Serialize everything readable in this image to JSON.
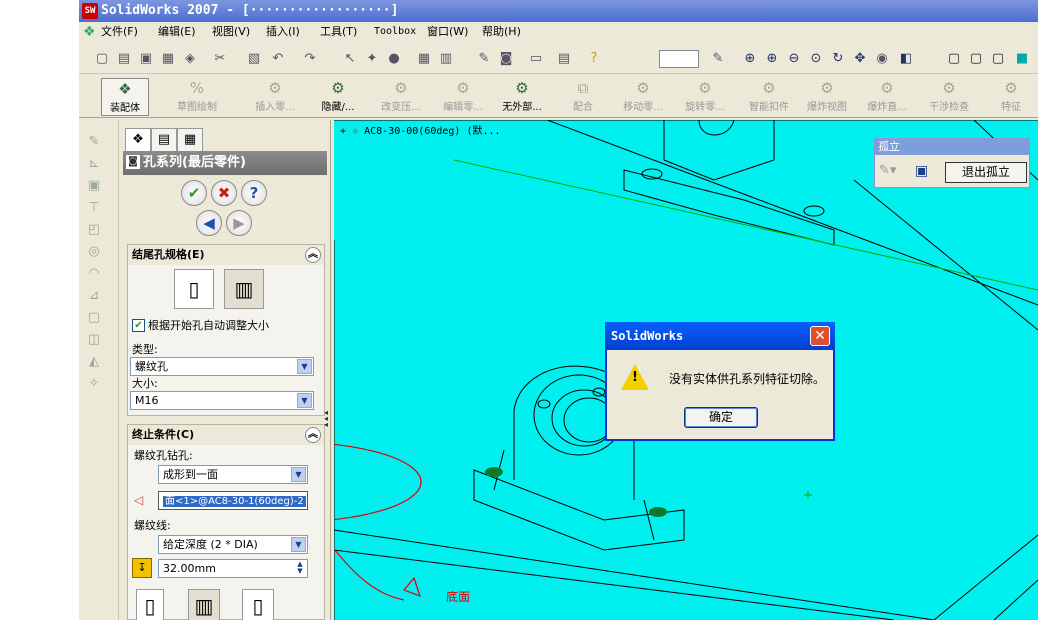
{
  "window": {
    "logo": "SW",
    "title": "SolidWorks 2007 - [··················]"
  },
  "menu": [
    "文件(F)",
    "编辑(E)",
    "视图(V)",
    "插入(I)",
    "工具(T)",
    "Toolbox",
    "窗口(W)",
    "帮助(H)"
  ],
  "command_bar": [
    {
      "label": "装配体",
      "active": true
    },
    {
      "label": "草图绘制",
      "active": false
    },
    {
      "label": "插入零...",
      "active": false
    },
    {
      "label": "隐藏/...",
      "active": true
    },
    {
      "label": "改变压...",
      "active": false
    },
    {
      "label": "编辑零...",
      "active": false
    },
    {
      "label": "无外部...",
      "active": true
    },
    {
      "label": "配合",
      "active": false
    },
    {
      "label": "移动零...",
      "active": false
    },
    {
      "label": "旋转零...",
      "active": false
    },
    {
      "label": "智能扣件",
      "active": false
    },
    {
      "label": "爆炸视图",
      "active": false
    },
    {
      "label": "爆炸直...",
      "active": false
    },
    {
      "label": "干涉检查",
      "active": false
    },
    {
      "label": "特征",
      "active": false
    }
  ],
  "property_manager": {
    "title": "孔系列(最后零件)",
    "ok": "✔",
    "cancel": "✖",
    "help": "?",
    "back": "◀",
    "next": "▶",
    "group1": {
      "header": "结尾孔规格(E)",
      "auto_size_label": "根据开始孔自动调整大小",
      "type_label": "类型:",
      "type_value": "螺纹孔",
      "size_label": "大小:",
      "size_value": "M16"
    },
    "group2": {
      "header": "终止条件(C)",
      "drill_label": "螺纹孔钻孔:",
      "drill_value": "成形到一面",
      "face_value": "面<1>@AC8-30-1(60deg)-2",
      "thread_label": "螺纹线:",
      "thread_value": "给定深度 (2 * DIA)",
      "depth_value": "32.00mm"
    }
  },
  "viewport": {
    "tree_label": "AC8-30-00(60deg)  (默...",
    "annotation": "底面"
  },
  "isolate": {
    "header": "孤立",
    "exit_button": "退出孤立"
  },
  "dialog": {
    "title": "SolidWorks",
    "message": "没有实体供孔系列特征切除。",
    "ok_label": "确定"
  }
}
